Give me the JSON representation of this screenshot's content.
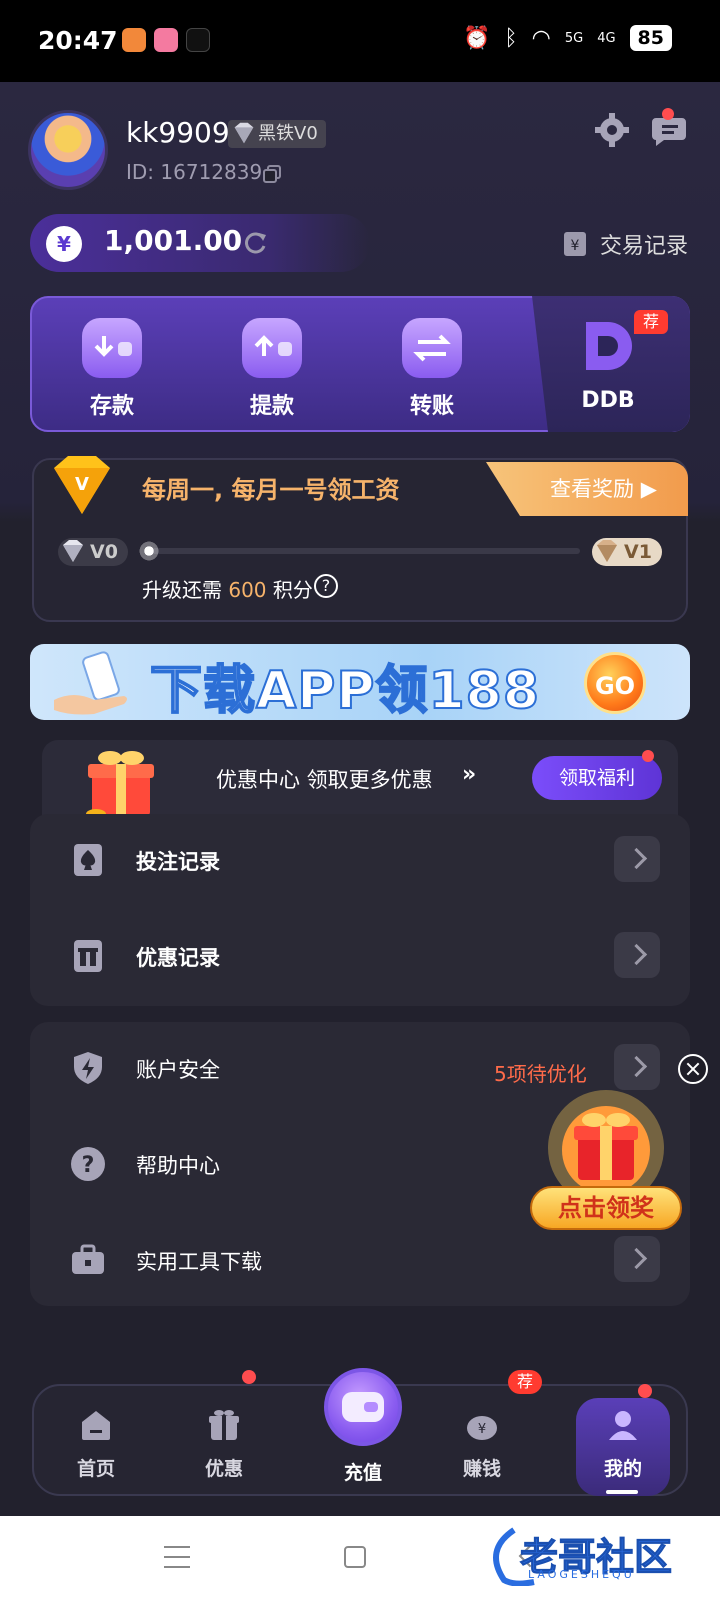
{
  "status_bar": {
    "time": "20:47",
    "battery": "85",
    "network_1": "5G",
    "network_2": "4G",
    "icons": [
      "alarm-icon",
      "bluetooth-icon",
      "wifi-icon",
      "signal-icon",
      "signal-icon"
    ]
  },
  "profile": {
    "username": "kk9909",
    "vip_badge": "黑铁V0",
    "id_text": "ID: 16712839"
  },
  "wallet": {
    "currency_symbol": "¥",
    "balance": "1,001.00",
    "transactions_label": "交易记录"
  },
  "quick_actions": [
    {
      "label": "存款",
      "icon": "deposit-icon"
    },
    {
      "label": "提款",
      "icon": "withdraw-icon"
    },
    {
      "label": "转账",
      "icon": "transfer-icon"
    },
    {
      "label": "DDB",
      "icon": "ddb-logo-icon",
      "tag": "荐"
    }
  ],
  "vip_card": {
    "title": "每周一, 每月一号领工资",
    "view_reward": "查看奖励",
    "current_level": "V0",
    "next_level": "V1",
    "upgrade_prefix": "升级还需",
    "points_needed": "600",
    "upgrade_suffix": "积分",
    "progress": 0
  },
  "banner": {
    "text": "下载APP领188",
    "go": "GO"
  },
  "promo": {
    "text": "优惠中心 领取更多优惠",
    "arrow": "»",
    "button": "领取福利"
  },
  "records": [
    {
      "label": "投注记录",
      "icon": "spade-icon"
    },
    {
      "label": "优惠记录",
      "icon": "gift-box-icon"
    }
  ],
  "settings": [
    {
      "label": "账户安全",
      "icon": "shield-icon",
      "note": "5项待优化"
    },
    {
      "label": "帮助中心",
      "icon": "question-icon"
    },
    {
      "label": "实用工具下载",
      "icon": "toolbox-icon"
    }
  ],
  "floating": {
    "label": "点击领奖"
  },
  "tabbar": [
    {
      "label": "首页",
      "icon": "home-icon"
    },
    {
      "label": "优惠",
      "icon": "gift-icon"
    },
    {
      "label": "充值",
      "icon": "wallet-icon"
    },
    {
      "label": "赚钱",
      "icon": "coin-bag-icon",
      "tag": "荐"
    },
    {
      "label": "我的",
      "icon": "user-icon"
    }
  ],
  "watermark": {
    "text": "老哥社区",
    "sub": "LAOGESHEQU"
  },
  "colors": {
    "accent": "#6b3fe0",
    "orange": "#f6b36b",
    "warning": "#ff6b4a"
  }
}
